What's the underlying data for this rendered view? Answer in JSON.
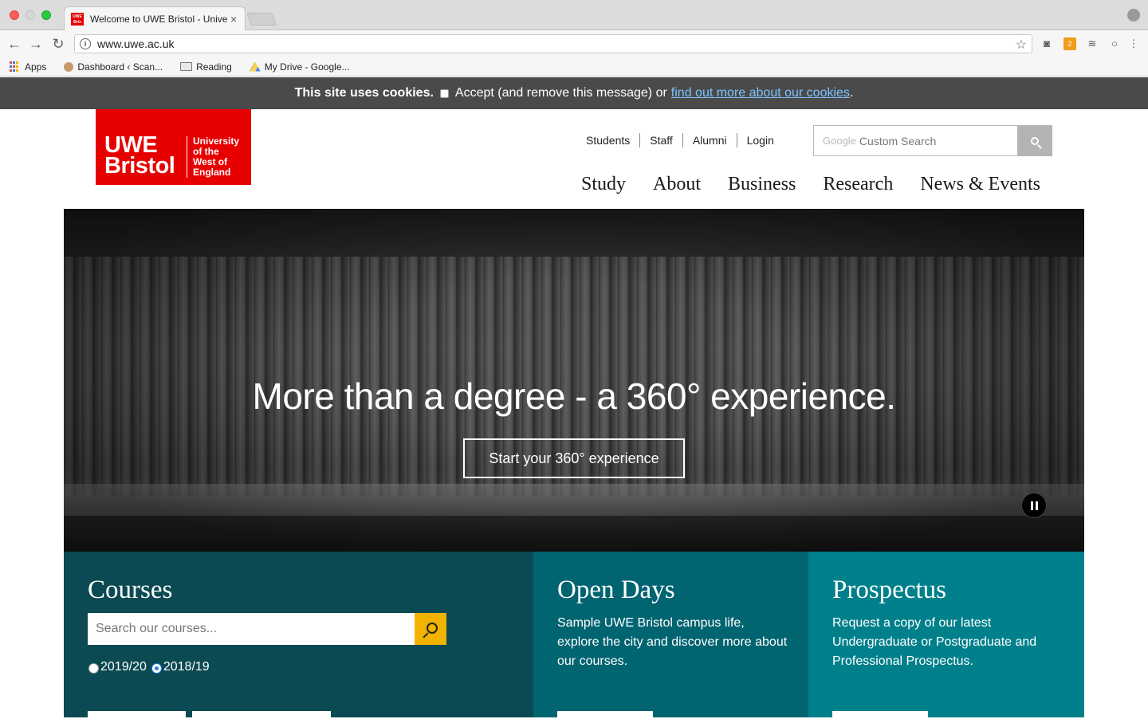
{
  "browser": {
    "tab_title": "Welcome to UWE Bristol - University of the West of England",
    "tab_close": "×",
    "url": "www.uwe.ac.uk",
    "bookmarks": [
      {
        "label": "Apps",
        "icon": "apps-grid-icon"
      },
      {
        "label": "Dashboard ‹ Scan...",
        "icon": "dashboard-icon"
      },
      {
        "label": "Reading",
        "icon": "folder-icon"
      },
      {
        "label": "My Drive - Google...",
        "icon": "google-drive-icon"
      }
    ]
  },
  "cookies": {
    "bold": "This site uses cookies.",
    "text": "Accept (and remove this message) or",
    "link": "find out more about our cookies",
    "end": "."
  },
  "logo": {
    "line1": "UWE",
    "line2": "Bristol",
    "small1": "University",
    "small2": "of the",
    "small3": "West of",
    "small4": "England",
    "brand_color": "#e60000"
  },
  "utility_nav": [
    "Students",
    "Staff",
    "Alumni",
    "Login"
  ],
  "search": {
    "google": "Google",
    "placeholder": "Custom Search"
  },
  "main_nav": [
    "Study",
    "About",
    "Business",
    "Research",
    "News & Events"
  ],
  "hero": {
    "title": "More than a degree - a 360° experience.",
    "cta": "Start your 360° experience"
  },
  "panels": {
    "courses": {
      "title": "Courses",
      "placeholder": "Search our courses...",
      "years": [
        {
          "label": "2019/20",
          "selected": false
        },
        {
          "label": "2018/19",
          "selected": true
        }
      ],
      "color": "#0b4a52"
    },
    "open_days": {
      "title": "Open Days",
      "text": "Sample UWE Bristol campus life, explore the city and discover more about our courses.",
      "color": "#006471"
    },
    "prospectus": {
      "title": "Prospectus",
      "text": "Request a copy of our latest Undergraduate or Postgraduate and Professional Prospectus.",
      "color": "#00808b"
    }
  }
}
